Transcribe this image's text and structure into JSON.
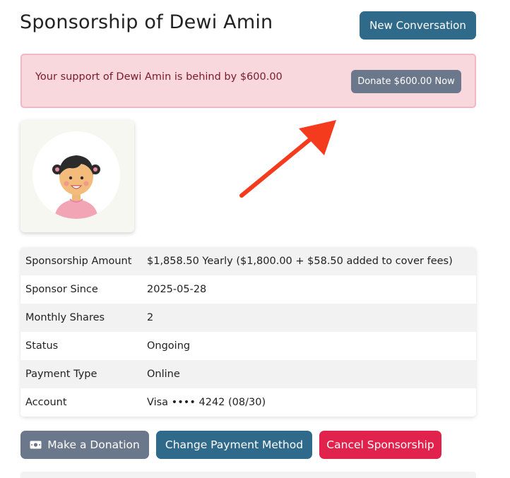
{
  "page": {
    "title": "Sponsorship of Dewi Amin",
    "new_conversation_label": "New Conversation"
  },
  "alert": {
    "message": "Your support of Dewi Amin is behind by $600.00",
    "donate_now_label": "Donate $600.00 Now"
  },
  "avatar": {
    "icon": "girl-avatar-icon"
  },
  "details": [
    {
      "label": "Sponsorship Amount",
      "value": "$1,858.50 Yearly ($1,800.00 + $58.50 added to cover fees)"
    },
    {
      "label": "Sponsor Since",
      "value": "2025-05-28"
    },
    {
      "label": "Monthly Shares",
      "value": "2"
    },
    {
      "label": "Status",
      "value": "Ongoing"
    },
    {
      "label": "Payment Type",
      "value": "Online"
    },
    {
      "label": "Account",
      "value": "Visa •••• 4242 (08/30)"
    }
  ],
  "actions": {
    "make_donation_label": "Make a Donation",
    "change_payment_label": "Change Payment Method",
    "cancel_label": "Cancel Sponsorship"
  },
  "colors": {
    "primary": "#2f6a8a",
    "secondary": "#6b778a",
    "danger": "#e0224c",
    "alert_bg": "#f8d7dd",
    "annotation_arrow": "#f53b1e"
  }
}
